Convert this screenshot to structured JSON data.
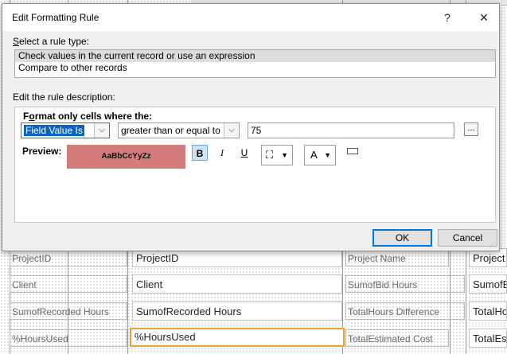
{
  "background": {
    "rows": [
      {
        "label": "ProjectID",
        "field": "ProjectID",
        "label2": "Project Name",
        "field2": "Project"
      },
      {
        "label": "Client",
        "field": "Client",
        "label2": "SumofBid Hours",
        "field2": "SumofBid"
      },
      {
        "label": "SumofRecorded Hours",
        "field": "SumofRecorded Hours",
        "label2": "TotalHours Difference",
        "field2": "TotalHo"
      },
      {
        "label": "%HoursUsed",
        "field": "%HoursUsed",
        "label2": "TotalEstimated Cost",
        "field2": "TotalEs"
      }
    ]
  },
  "dialog": {
    "title": "Edit Formatting Rule",
    "help_glyph": "?",
    "close_glyph": "✕",
    "select_type_label_key": "S",
    "select_type_label_rest": "elect a rule type:",
    "rule_types": [
      "Check values in the current record or use an expression",
      "Compare to other records"
    ],
    "edit_desc_label": "Edit the rule description:",
    "format_only_label_pre": "F",
    "format_only_label_key": "o",
    "format_only_label_rest": "rmat only cells where the:",
    "condition_field": "Field Value Is",
    "condition_operator": "greater than or equal to",
    "condition_value": "75",
    "ellipsis": "...",
    "preview_label": "Preview:",
    "preview_sample": "AaBbCcYyZz",
    "bold": "B",
    "italic": "I",
    "underline": "U",
    "font_color": "A",
    "ok": "OK",
    "cancel": "Cancel"
  },
  "colors": {
    "preview_fill": "#d47b7b",
    "selection": "#0a64c8",
    "field_focus": "#f0a030"
  }
}
